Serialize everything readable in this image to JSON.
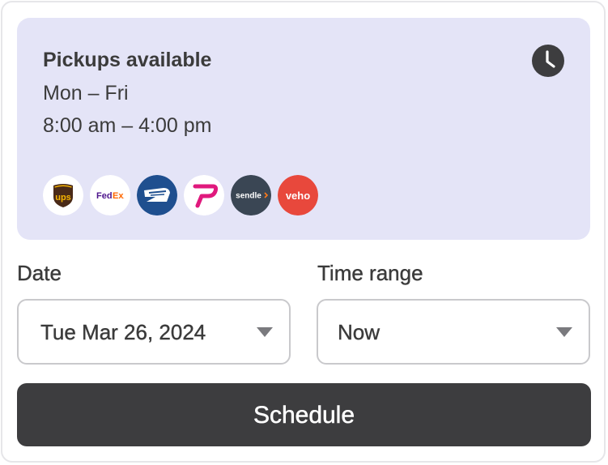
{
  "pickup": {
    "title": "Pickups available",
    "days": "Mon – Fri",
    "hours": "8:00 am – 4:00 pm",
    "icon": "clock-icon",
    "panel_color": "#e4e4f7"
  },
  "carriers": [
    {
      "name": "UPS",
      "label": "ups",
      "icon": "ups-logo"
    },
    {
      "name": "FedEx",
      "label": "FedEx",
      "icon": "fedex-logo"
    },
    {
      "name": "USPS",
      "label": "",
      "icon": "usps-logo"
    },
    {
      "name": "Passport",
      "label": "",
      "icon": "passport-logo"
    },
    {
      "name": "Sendle",
      "label": "sendle",
      "icon": "sendle-logo"
    },
    {
      "name": "Veho",
      "label": "veho",
      "icon": "veho-logo"
    }
  ],
  "form": {
    "date_label": "Date",
    "date_value": "Tue Mar 26, 2024",
    "time_label": "Time range",
    "time_value": "Now"
  },
  "actions": {
    "schedule_label": "Schedule",
    "button_color": "#3d3d3f"
  }
}
